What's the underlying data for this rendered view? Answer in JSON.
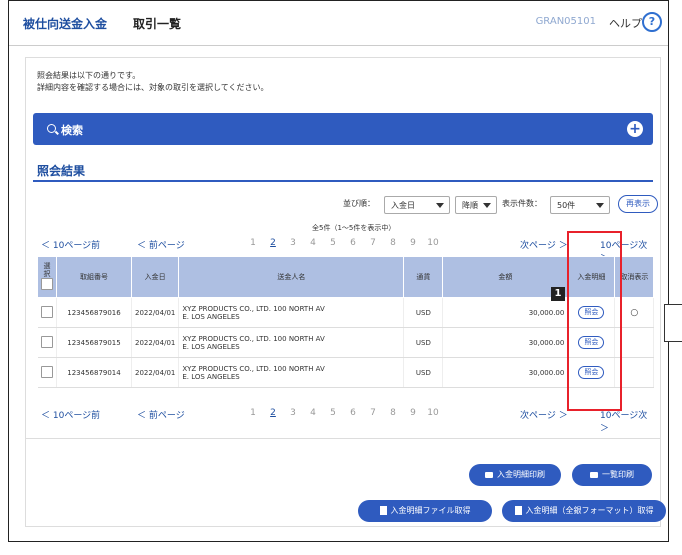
{
  "header": {
    "breadcrumb_app": "被仕向送金入金",
    "page_title": "取引一覧",
    "screen_id": "GRAN05101",
    "help_label": "ヘルプ",
    "help_icon": "?"
  },
  "intro": {
    "line1": "照会結果は以下の通りです。",
    "line2": "詳細内容を確認する場合には、対象の取引を選択してください。"
  },
  "search": {
    "label": "検索",
    "icon": "search-icon",
    "expand_icon": "+"
  },
  "results": {
    "title": "照会結果",
    "sort_label": "並び順：",
    "sort_field": "入金日",
    "sort_order": "降順",
    "per_page_label": "表示件数：",
    "per_page": "50件",
    "redisplay_label": "再表示",
    "count_text": "全5件（1～5件を表示中）"
  },
  "pager": {
    "prev10": "10ページ前",
    "prev": "前ページ",
    "pages": [
      "1",
      "2",
      "3",
      "4",
      "5",
      "6",
      "7",
      "8",
      "9",
      "10"
    ],
    "current": "2",
    "next": "次ページ",
    "next10": "10ページ次",
    "chev_left": "＜",
    "chev_right": "＞"
  },
  "table": {
    "headers": {
      "select": "選択",
      "ref_no": "取組番号",
      "date": "入金日",
      "remitter": "送金人名",
      "currency": "通貨",
      "amount": "金額",
      "receipt": "入金明細",
      "cancel": "取消表示"
    },
    "rows": [
      {
        "ref_no": "123456879016",
        "date": "2022/04/01",
        "remitter_l1": "XYZ PRODUCTS CO., LTD. 100 NORTH AV",
        "remitter_l2": "E. LOS ANGELES",
        "currency": "USD",
        "amount": "30,000.00",
        "receipt_btn": "照会",
        "cancel": "○"
      },
      {
        "ref_no": "123456879015",
        "date": "2022/04/01",
        "remitter_l1": "XYZ PRODUCTS CO., LTD. 100 NORTH AV",
        "remitter_l2": "E. LOS ANGELES",
        "currency": "USD",
        "amount": "30,000.00",
        "receipt_btn": "照会",
        "cancel": ""
      },
      {
        "ref_no": "123456879014",
        "date": "2022/04/01",
        "remitter_l1": "XYZ PRODUCTS CO., LTD. 100 NORTH AV",
        "remitter_l2": "E. LOS ANGELES",
        "currency": "USD",
        "amount": "30,000.00",
        "receipt_btn": "照会",
        "cancel": ""
      }
    ]
  },
  "annotation": {
    "marker": "1",
    "highlight_color": "#e8212b"
  },
  "actions": {
    "print_receipt": "入金明細印刷",
    "print_list": "一覧印刷",
    "file_get": "入金明細ファイル取得",
    "file_get_all": "入金明細（全銀フォーマット）取得"
  },
  "colors": {
    "primary": "#2f5bbf",
    "header_bg": "#aebfe2",
    "title": "#1f4fa0"
  }
}
